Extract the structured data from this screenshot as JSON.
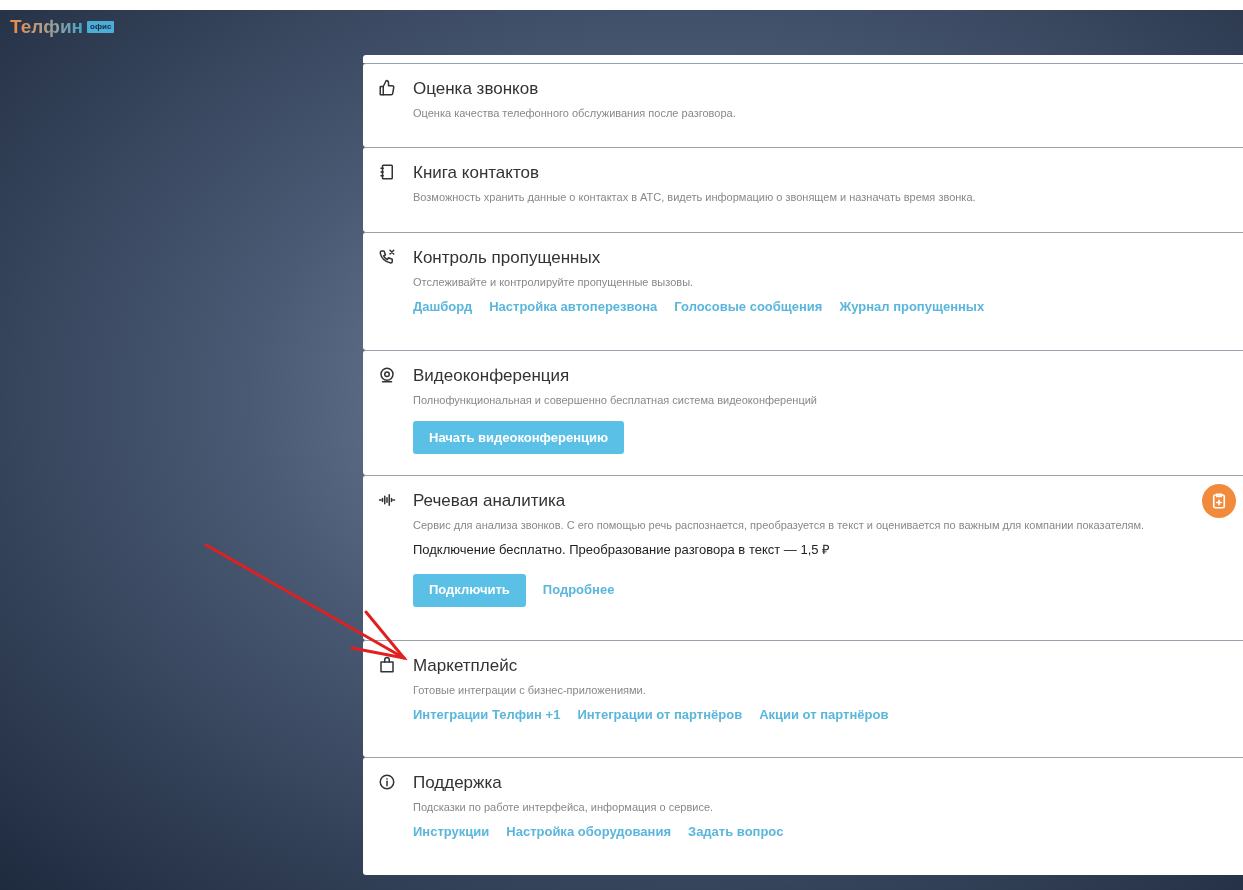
{
  "logo": {
    "name": "Телфин",
    "badge": "офис"
  },
  "sections": [
    {
      "title": "Оценка звонков",
      "description": "Оценка качества телефонного обслуживания после разговора."
    },
    {
      "title": "Книга контактов",
      "description": "Возможность хранить данные о контактах в АТС, видеть информацию о звонящем и назначать время звонка."
    },
    {
      "title": "Контроль пропущенных",
      "description": "Отслеживайте и контролируйте пропущенные вызовы.",
      "actions": [
        {
          "kind": "link",
          "label": "Дашборд"
        },
        {
          "kind": "link",
          "label": "Настройка автоперезвона"
        },
        {
          "kind": "link",
          "label": "Голосовые сообщения"
        },
        {
          "kind": "link",
          "label": "Журнал пропущенных"
        }
      ]
    },
    {
      "title": "Видеоконференция",
      "description": "Полнофункциональная и совершенно бесплатная система видеоконференций",
      "actions": [
        {
          "kind": "button",
          "label": "Начать видеоконференцию"
        }
      ]
    },
    {
      "title": "Речевая аналитика",
      "description": "Сервис для анализа звонков. С его помощью речь распознается, преобразуется в текст и оценивается по важным для компании показателям.",
      "note": "Подключение бесплатно. Преобразование разговора в текст — 1,5 ₽",
      "actions": [
        {
          "kind": "button",
          "label": "Подключить"
        },
        {
          "kind": "link",
          "label": "Подробнее"
        }
      ]
    },
    {
      "title": "Маркетплейс",
      "description": "Готовые интеграции с бизнес-приложениями.",
      "actions": [
        {
          "kind": "link",
          "label": "Интеграции Телфин +1"
        },
        {
          "kind": "link",
          "label": "Интеграции от партнёров"
        },
        {
          "kind": "link",
          "label": "Акции от партнёров"
        }
      ]
    },
    {
      "title": "Поддержка",
      "description": "Подсказки по работе интерфейса, информация о сервисе.",
      "actions": [
        {
          "kind": "link",
          "label": "Инструкции"
        },
        {
          "kind": "link",
          "label": "Настройка оборудования"
        },
        {
          "kind": "link",
          "label": "Задать вопрос"
        }
      ]
    }
  ],
  "annotations": [
    {
      "kind": "arrow"
    }
  ]
}
